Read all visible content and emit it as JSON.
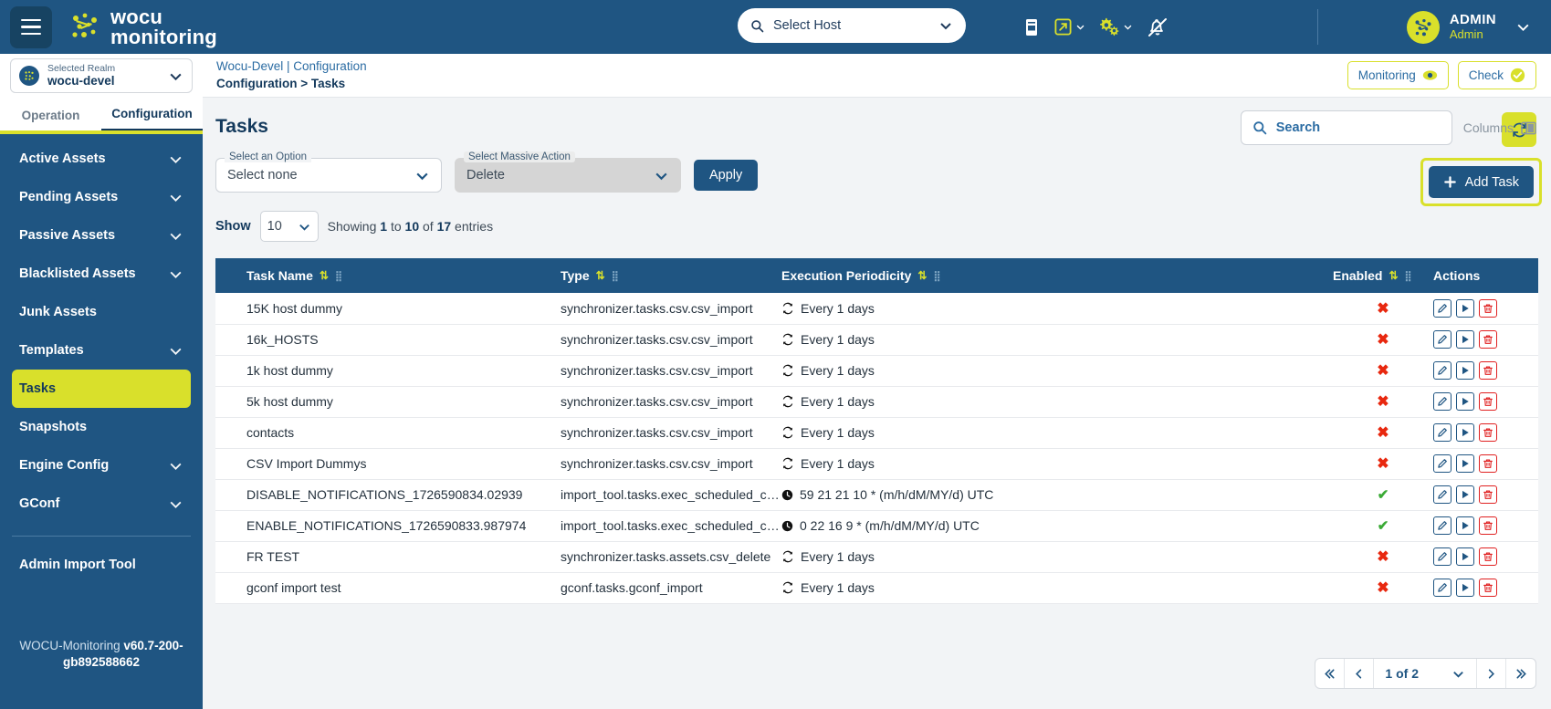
{
  "topbar": {
    "menu_icon": "hamburger-icon",
    "brand_line1": "wocu",
    "brand_line2": "monitoring",
    "host_select_placeholder": "Select Host",
    "icons": [
      "document-icon",
      "external-link-icon",
      "gears-icon",
      "bell-slash-icon"
    ],
    "user_name": "ADMIN",
    "user_role": "Admin"
  },
  "realm": {
    "label": "Selected Realm",
    "value": "wocu-devel"
  },
  "tabs": [
    {
      "label": "Operation",
      "active": false
    },
    {
      "label": "Configuration",
      "active": true
    }
  ],
  "sidebar": {
    "items": [
      {
        "label": "Active Assets",
        "chevron": true,
        "active": false
      },
      {
        "label": "Pending Assets",
        "chevron": true,
        "active": false
      },
      {
        "label": "Passive Assets",
        "chevron": true,
        "active": false
      },
      {
        "label": "Blacklisted Assets",
        "chevron": true,
        "active": false
      },
      {
        "label": "Junk Assets",
        "chevron": false,
        "active": false
      },
      {
        "label": "Templates",
        "chevron": true,
        "active": false
      },
      {
        "label": "Tasks",
        "chevron": false,
        "active": true
      },
      {
        "label": "Snapshots",
        "chevron": false,
        "active": false
      },
      {
        "label": "Engine Config",
        "chevron": true,
        "active": false
      },
      {
        "label": "GConf",
        "chevron": true,
        "active": false
      }
    ],
    "admin_tool": "Admin Import Tool",
    "version_prefix": "WOCU-Monitoring ",
    "version_value": "v60.7-200-gb892588662"
  },
  "breadcrumb": {
    "line1": "Wocu-Devel | Configuration",
    "line2": "Configuration > Tasks",
    "monitoring_label": "Monitoring",
    "check_label": "Check"
  },
  "page": {
    "title": "Tasks",
    "refresh_icon": "refresh-icon"
  },
  "filters": {
    "option_label": "Select an Option",
    "option_value": "Select none",
    "massive_label": "Select Massive Action",
    "massive_value": "Delete",
    "apply_label": "Apply"
  },
  "showbar": {
    "show_label": "Show",
    "page_size": "10",
    "showing_prefix": "Showing ",
    "showing_from": "1",
    "showing_mid": " to ",
    "showing_to": "10",
    "showing_of": " of ",
    "showing_total": "17",
    "showing_suffix": " entries"
  },
  "search": {
    "placeholder": "Search",
    "columns_label": "Columns"
  },
  "add_task": {
    "label": "Add Task"
  },
  "table": {
    "columns": [
      {
        "label": "Task Name",
        "sortable": true
      },
      {
        "label": "Type",
        "sortable": true
      },
      {
        "label": "Execution Periodicity",
        "sortable": true
      },
      {
        "label": "Enabled",
        "sortable": true
      },
      {
        "label": "Actions",
        "sortable": false
      }
    ],
    "rows": [
      {
        "name": "15K host dummy",
        "type": "synchronizer.tasks.csv.csv_import",
        "periodicity": "Every 1 days",
        "periodicity_icon": "repeat-icon",
        "enabled": false
      },
      {
        "name": "16k_HOSTS",
        "type": "synchronizer.tasks.csv.csv_import",
        "periodicity": "Every 1 days",
        "periodicity_icon": "repeat-icon",
        "enabled": false
      },
      {
        "name": "1k host dummy",
        "type": "synchronizer.tasks.csv.csv_import",
        "periodicity": "Every 1 days",
        "periodicity_icon": "repeat-icon",
        "enabled": false
      },
      {
        "name": "5k host dummy",
        "type": "synchronizer.tasks.csv.csv_import",
        "periodicity": "Every 1 days",
        "periodicity_icon": "repeat-icon",
        "enabled": false
      },
      {
        "name": "contacts",
        "type": "synchronizer.tasks.csv.csv_import",
        "periodicity": "Every 1 days",
        "periodicity_icon": "repeat-icon",
        "enabled": false
      },
      {
        "name": "CSV Import Dummys",
        "type": "synchronizer.tasks.csv.csv_import",
        "periodicity": "Every 1 days",
        "periodicity_icon": "repeat-icon",
        "enabled": false
      },
      {
        "name": "DISABLE_NOTIFICATIONS_1726590834.02939",
        "type": "import_tool.tasks.exec_scheduled_co…",
        "periodicity": "59 21 21 10 * (m/h/dM/MY/d) UTC",
        "periodicity_icon": "clock-icon",
        "enabled": true
      },
      {
        "name": "ENABLE_NOTIFICATIONS_1726590833.987974",
        "type": "import_tool.tasks.exec_scheduled_co…",
        "periodicity": "0 22 16 9 * (m/h/dM/MY/d) UTC",
        "periodicity_icon": "clock-icon",
        "enabled": true
      },
      {
        "name": "FR TEST",
        "type": "synchronizer.tasks.assets.csv_delete",
        "periodicity": "Every 1 days",
        "periodicity_icon": "repeat-icon",
        "enabled": false
      },
      {
        "name": "gconf import test",
        "type": "gconf.tasks.gconf_import",
        "periodicity": "Every 1 days",
        "periodicity_icon": "repeat-icon",
        "enabled": false
      }
    ],
    "row_actions": [
      "edit-icon",
      "run-icon",
      "delete-icon"
    ]
  },
  "pagination": {
    "first_icon": "chevron-double-left-icon",
    "prev_icon": "chevron-left-icon",
    "page_text": "1 of 2",
    "next_icon": "chevron-right-icon",
    "last_icon": "chevron-double-right-icon"
  },
  "colors": {
    "brand_blue": "#1f5582",
    "accent_yellow": "#d9e02b",
    "danger_red": "#e8280f",
    "success_green": "#3aaa35"
  }
}
